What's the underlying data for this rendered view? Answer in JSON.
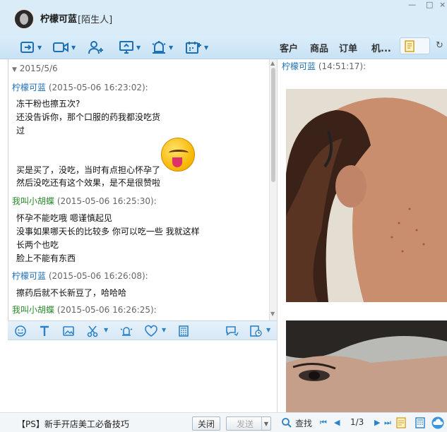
{
  "header": {
    "contact_name": "柠檬可蓝",
    "contact_tag": "[陌生人]"
  },
  "toolbar": {
    "tabs": [
      "客户",
      "商品",
      "订单",
      "机..."
    ],
    "icons": [
      "send-file-icon",
      "video-call-icon",
      "add-contact-icon",
      "screen-share-icon",
      "alarm-icon",
      "schedule-icon"
    ]
  },
  "chat": {
    "date": "2015/5/6",
    "messages": [
      {
        "sender": "柠檬可蓝",
        "time": "(2015-05-06 16:23:02):",
        "lines": [
          "冻干粉也擦五次?",
          "还没告诉你，那个口服的药我都没吃货",
          "过",
          "",
          "买是买了，没吃，当时有点担心怀孕了",
          "然后没吃还有这个效果，是不是很赞啦"
        ]
      },
      {
        "sender": "我叫小胡蝶",
        "time": "(2015-05-06 16:25:30):",
        "lines": [
          "怀孕不能吃哦  嗯谨慎起见",
          "没事如果哪天长的比较多  你可以吃一些  我就这样",
          "长两个也吃",
          "脸上不能有东西"
        ]
      },
      {
        "sender": "柠檬可蓝",
        "time": "(2015-05-06 16:26:08):",
        "lines": [
          "擦药后就不长新豆了，哈哈哈"
        ]
      },
      {
        "sender": "我叫小胡蝶",
        "time": "(2015-05-06 16:26:25):",
        "lines": []
      }
    ]
  },
  "bottom": {
    "promo": "【PS】新手开店美工必备技巧",
    "close_label": "关闭",
    "send_label": "发送"
  },
  "right": {
    "sender": "柠檬可蓝",
    "time": "(14:51:17):",
    "find_label": "查找",
    "page": "1/3"
  }
}
